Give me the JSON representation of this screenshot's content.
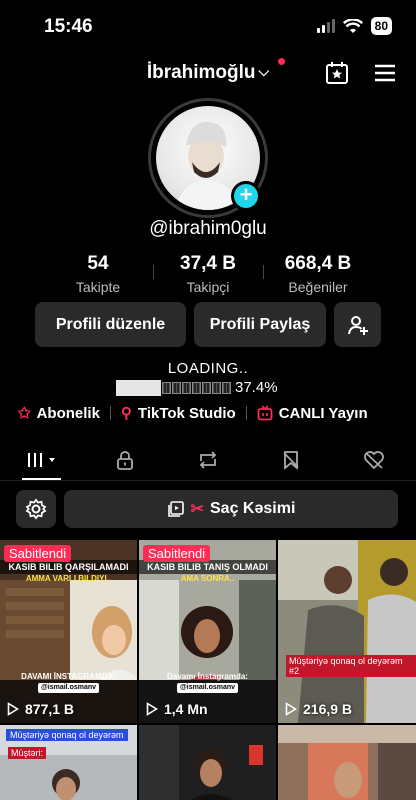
{
  "status_bar": {
    "time": "15:46",
    "battery": "80"
  },
  "header": {
    "username": "İbrahimoğlu"
  },
  "profile": {
    "handle": "@ibrahim0glu"
  },
  "stats": [
    {
      "value": "54",
      "label": "Takipte"
    },
    {
      "value": "37,4 B",
      "label": "Takipçi"
    },
    {
      "value": "668,4 B",
      "label": "Beğeniler"
    }
  ],
  "actions": {
    "edit_label": "Profili düzenle",
    "share_label": "Profili Paylaş"
  },
  "loading": {
    "text": "LOADING..",
    "percent_text": "37.4%",
    "progress": 0.374
  },
  "links": [
    {
      "label": "Abonelik",
      "icon": "star-icon"
    },
    {
      "label": "TikTok Studio",
      "icon": "studio-icon"
    },
    {
      "label": "CANLI Yayın",
      "icon": "live-icon"
    }
  ],
  "playlist": {
    "label": "Saç Kəsimi"
  },
  "videos": [
    {
      "pinned": "Sabitlendi",
      "caption_top": "KASIB BILIB QARŞILAMADI",
      "caption_sub": "AMMA VARLI BILDIYI..",
      "caption_bottom": "DAVAMI İNSTAGRAMDA:",
      "caption_user": "@ismail.osmanv",
      "views": "877,1 B"
    },
    {
      "pinned": "Sabitlendi",
      "caption_top": "KASIB BILIB TANIŞ OLMADI",
      "caption_sub": "AMA SONRA..",
      "caption_bottom": "Davamı İnstagramda:",
      "caption_user": "@ismail.osmanv",
      "views": "1,4 Mn"
    },
    {
      "caption_badge": "Müştəriyə qonaq ol deyərəm #2",
      "views": "216,9 B"
    },
    {
      "caption_blue": "Müştəriyə qonaq ol deyərəm",
      "caption_red": "Müştəri:"
    },
    {},
    {}
  ],
  "colors": {
    "accent": "#fe2c55",
    "add_badge": "#20d5ec",
    "button_bg": "#2a2a2a"
  }
}
